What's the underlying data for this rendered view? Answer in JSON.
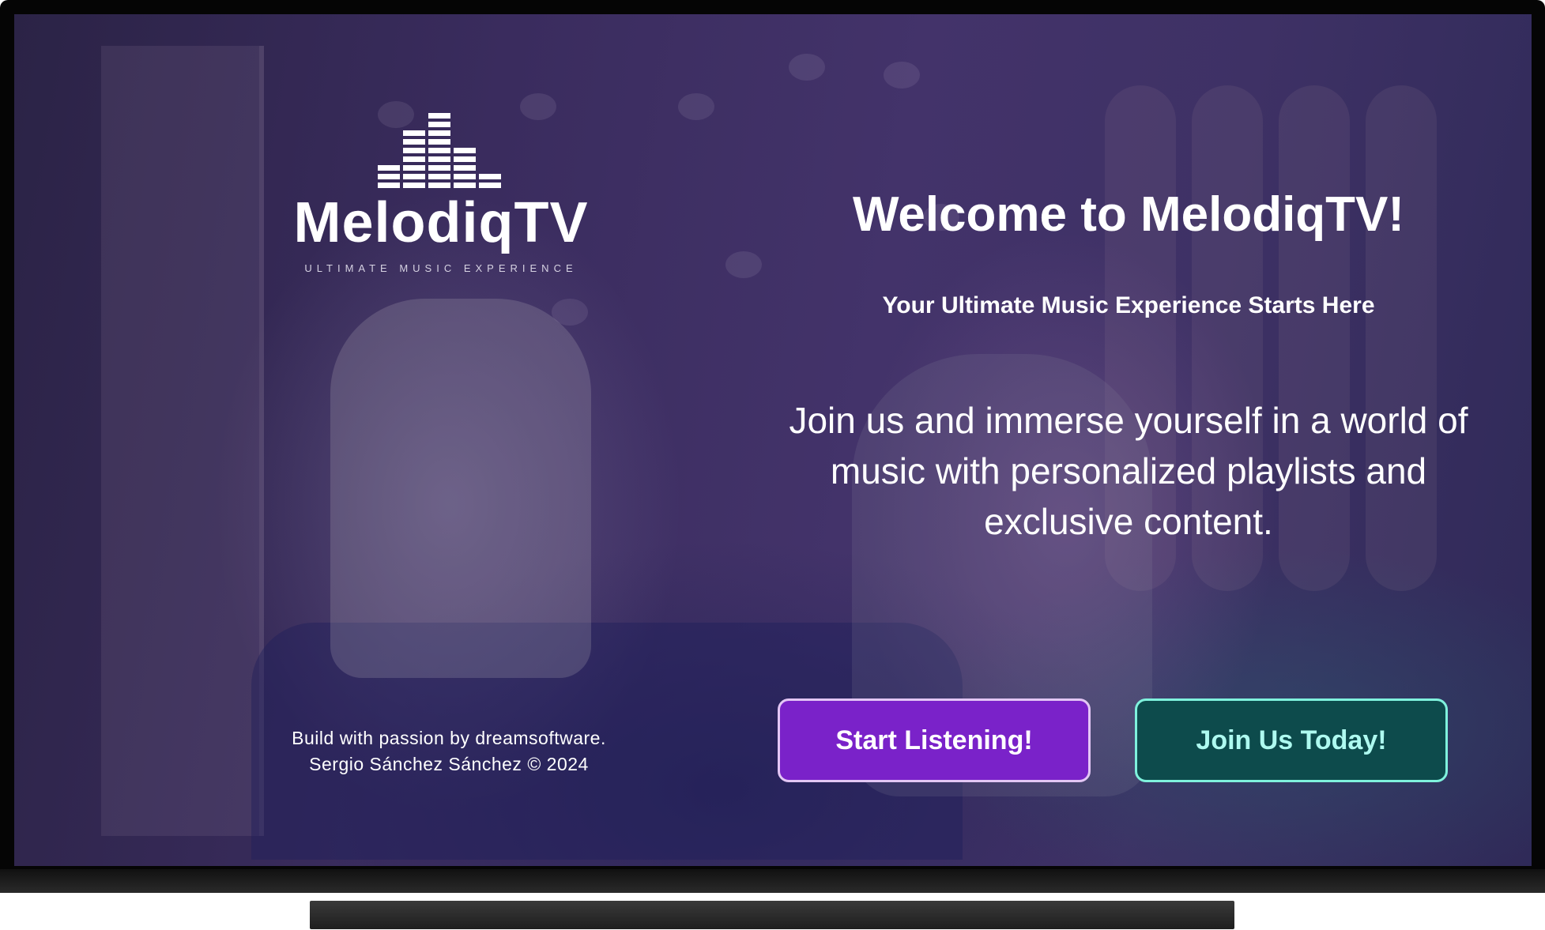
{
  "app": {
    "logo": {
      "name": "MelodiqTV",
      "tagline": "ULTIMATE MUSIC EXPERIENCE"
    },
    "welcome": {
      "title": "Welcome to MelodiqTV!",
      "subtitle": "Your Ultimate Music Experience Starts Here",
      "description": "Join us and immerse yourself in a world of music with personalized playlists and exclusive content."
    },
    "buttons": {
      "start_label": "Start Listening!",
      "join_label": "Join Us Today!"
    },
    "credits": {
      "line1": "Build with passion by dreamsoftware.",
      "line2": "Sergio Sánchez Sánchez © 2024"
    }
  },
  "colors": {
    "primary_button": "#7a22c9",
    "primary_border": "#e3c6f5",
    "secondary_button": "#0d4b4c",
    "secondary_border": "#7ff2dd"
  }
}
